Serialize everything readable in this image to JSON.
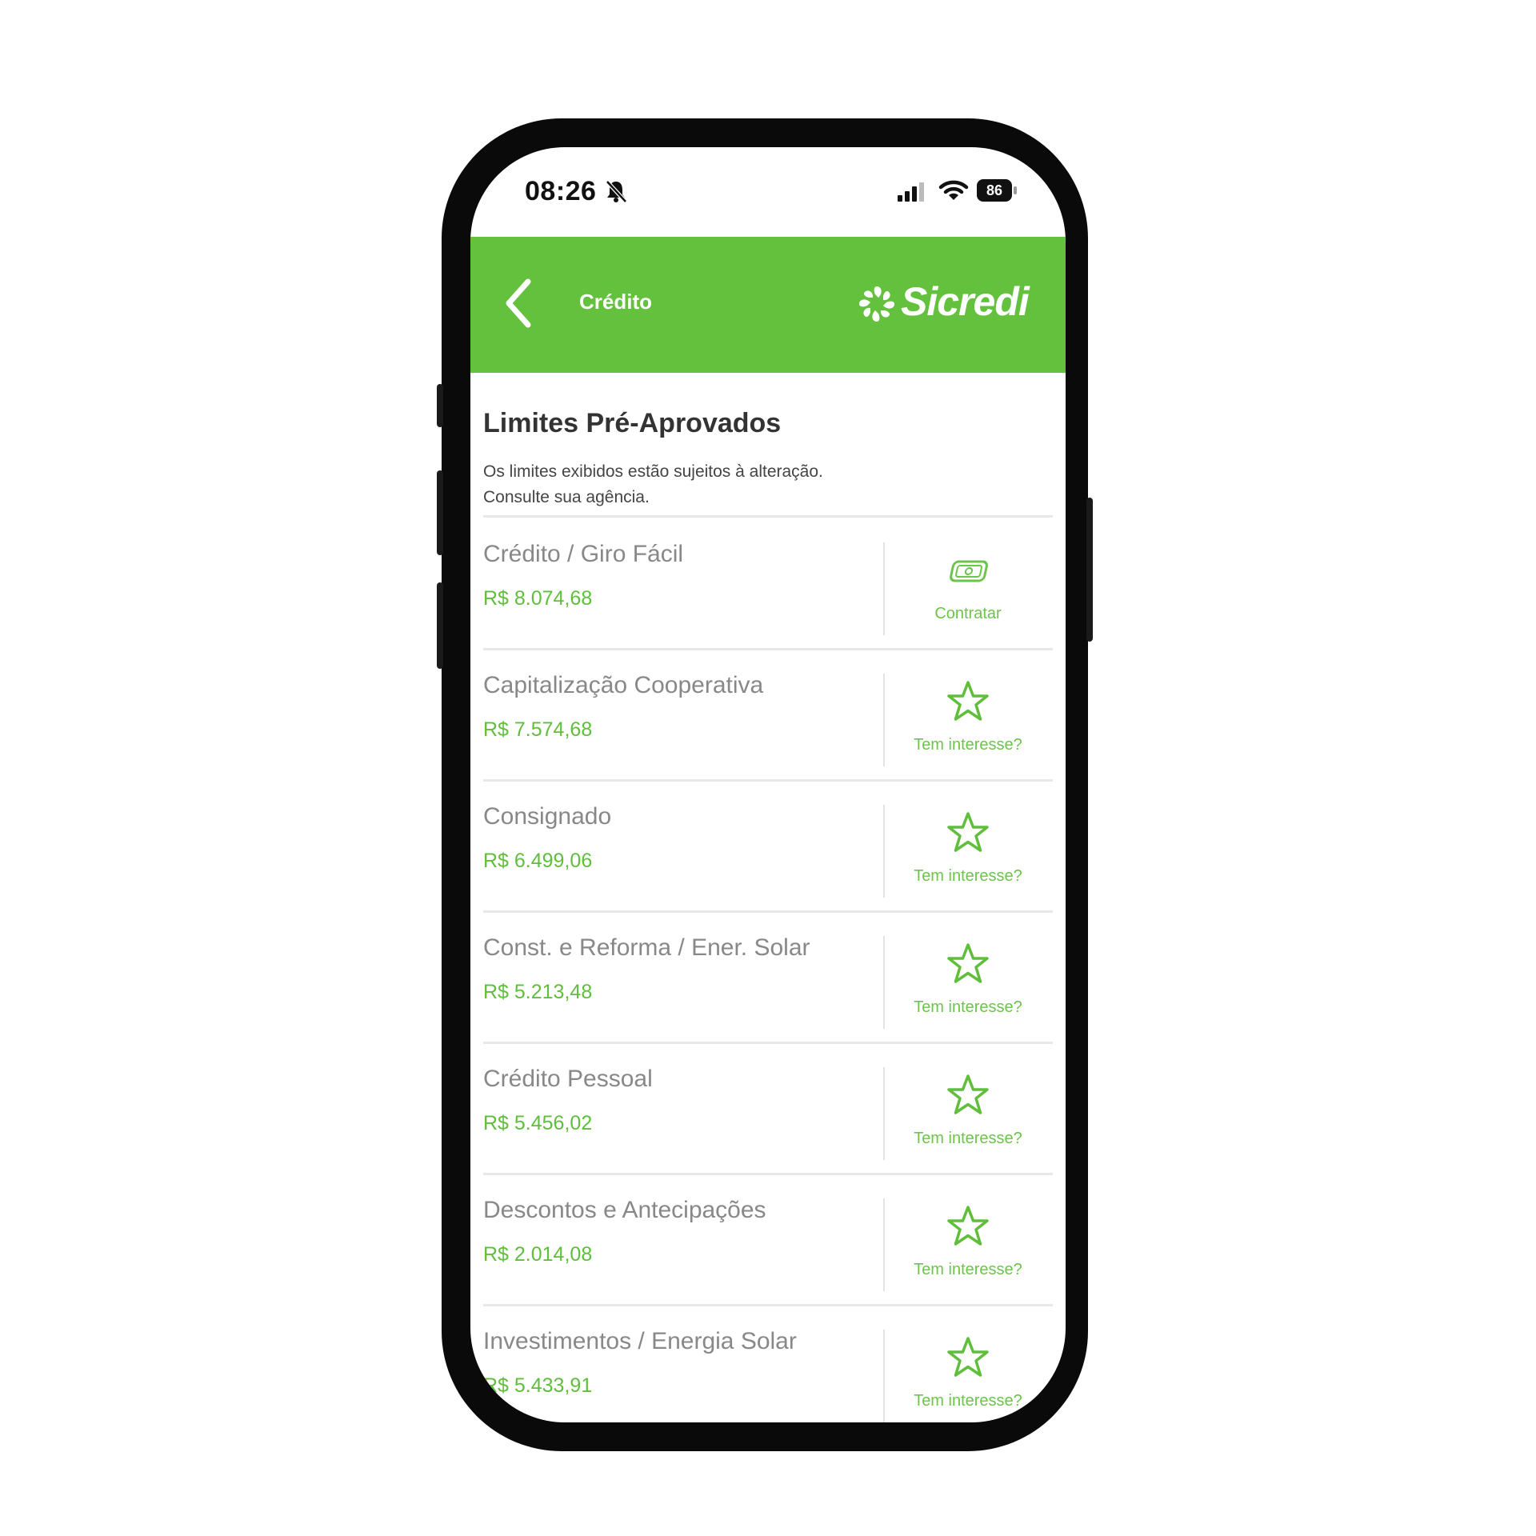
{
  "status_bar": {
    "time": "08:26",
    "battery": "86",
    "icons": [
      "bell-off-icon",
      "signal-icon",
      "wifi-icon",
      "battery-icon"
    ]
  },
  "header": {
    "title": "Crédito",
    "logo_text": "Sicredi",
    "brand_color": "#64c13e"
  },
  "page": {
    "title": "Limites Pré-Aprovados",
    "subtitle_line1": "Os limites exibidos estão sujeitos à alteração.",
    "subtitle_line2": "Consulte sua agência."
  },
  "items": [
    {
      "name": "Crédito / Giro Fácil",
      "value": "R$ 8.074,68",
      "action": "Contratar",
      "icon": "money-icon"
    },
    {
      "name": "Capitalização Cooperativa",
      "value": "R$ 7.574,68",
      "action": "Tem interesse?",
      "icon": "star-icon"
    },
    {
      "name": "Consignado",
      "value": "R$ 6.499,06",
      "action": "Tem interesse?",
      "icon": "star-icon"
    },
    {
      "name": "Const. e Reforma / Ener. Solar",
      "value": "R$ 5.213,48",
      "action": "Tem interesse?",
      "icon": "star-icon"
    },
    {
      "name": "Crédito Pessoal",
      "value": "R$ 5.456,02",
      "action": "Tem interesse?",
      "icon": "star-icon"
    },
    {
      "name": "Descontos e Antecipações",
      "value": "R$ 2.014,08",
      "action": "Tem interesse?",
      "icon": "star-icon"
    },
    {
      "name": "Investimentos / Energia Solar",
      "value": "R$ 5.433,91",
      "action": "Tem interesse?",
      "icon": "star-icon"
    }
  ]
}
